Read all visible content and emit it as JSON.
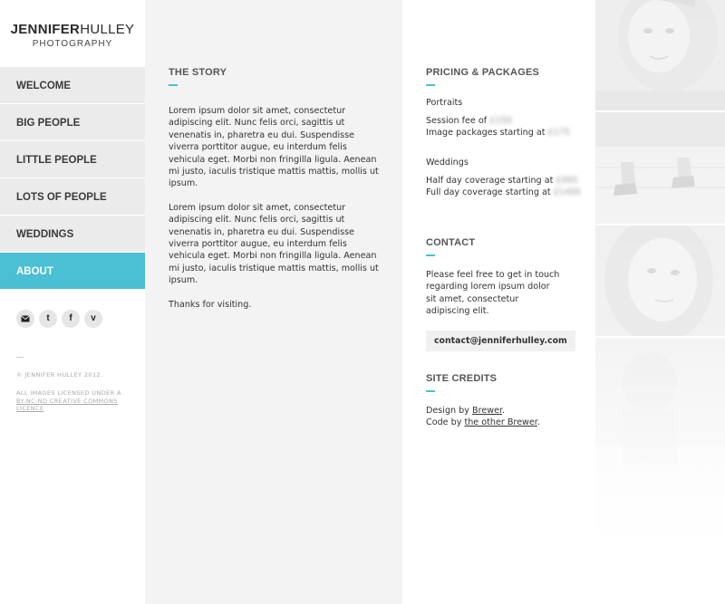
{
  "logo": {
    "first": "JENNIFER",
    "last": "HULLEY",
    "tagline": "PHOTOGRAPHY"
  },
  "nav": {
    "items": [
      {
        "label": "WELCOME"
      },
      {
        "label": "BIG PEOPLE"
      },
      {
        "label": "LITTLE PEOPLE"
      },
      {
        "label": "LOTS OF PEOPLE"
      },
      {
        "label": "WEDDINGS"
      },
      {
        "label": "ABOUT"
      }
    ],
    "active": "ABOUT"
  },
  "social": {
    "icons": [
      "email-icon",
      "twitter-icon",
      "facebook-icon",
      "vimeo-icon"
    ],
    "twitter_glyph": "t",
    "facebook_glyph": "f",
    "vimeo_glyph": "v"
  },
  "footer": {
    "copyright": "© JENNIFER HULLEY 2012.",
    "licensed": "ALL IMAGES LICENSED UNDER A",
    "licence_link": "BY-NC-ND CREATIVE COMMONS LICENCE"
  },
  "story": {
    "title": "THE STORY",
    "paragraphs": [
      "Lorem ipsum dolor sit amet, consectetur adipiscing elit. Nunc felis orci, sagittis ut venenatis in, pharetra eu dui. Suspendisse viverra porttitor augue, eu interdum felis vehicula eget. Morbi non fringilla ligula. Aenean mi justo, iaculis tristique mattis mattis, mollis ut ipsum.",
      "Lorem ipsum dolor sit amet, consectetur adipiscing elit. Nunc felis orci, sagittis ut venenatis in, pharetra eu dui. Suspendisse viverra porttitor augue, eu interdum felis vehicula eget. Morbi non fringilla ligula. Aenean mi justo, iaculis tristique mattis mattis, mollis ut ipsum.",
      "Thanks for visiting."
    ]
  },
  "pricing": {
    "title": "PRICING & PACKAGES",
    "portraits": {
      "heading": "Portraits",
      "session_label": "Session fee of",
      "session_value": "£150",
      "packages_label": "Image packages starting at",
      "packages_value": "£175"
    },
    "weddings": {
      "heading": "Weddings",
      "half_label": "Half day coverage starting at",
      "half_value": "£995",
      "full_label": "Full day coverage starting at",
      "full_value": "£1495"
    }
  },
  "contact": {
    "title": "CONTACT",
    "text": "Please feel free to get in touch regarding lorem ipsum dolor sit amet, consectetur adipiscing elit.",
    "email": "contact@jenniferhulley.com"
  },
  "credits": {
    "title": "SITE CREDITS",
    "design_prefix": "Design by ",
    "design_link": "Brewer",
    "design_suffix": ".",
    "code_prefix": "Code by ",
    "code_link": "the other Brewer",
    "code_suffix": "."
  },
  "colors": {
    "accent": "#4bbfd4",
    "sidebar_bg": "#ebebeb",
    "story_bg": "#f3f3f3"
  }
}
